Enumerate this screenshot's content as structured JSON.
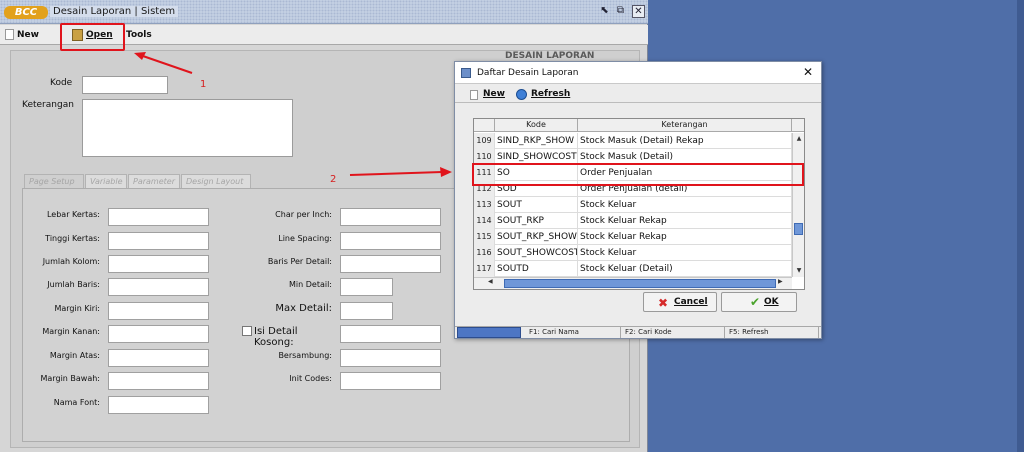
{
  "main_window": {
    "logo": "BCC",
    "title": "Desain Laporan | Sistem",
    "controls": {
      "minmax": "⬉",
      "restore": "⧉",
      "close": "✕"
    },
    "toolbar": {
      "new_label": "New",
      "open_label": "Open",
      "tools_label": "Tools"
    },
    "header": "DESAIN LAPORAN",
    "kode_label": "Kode",
    "keterangan_label": "Keterangan",
    "tabs": [
      "Page Setup",
      "Variable",
      "Parameter",
      "Design Layout"
    ],
    "left_fields": [
      "Lebar Kertas:",
      "Tinggi Kertas:",
      "Jumlah Kolom:",
      "Jumlah Baris:",
      "Margin Kiri:",
      "Margin Kanan:",
      "Margin Atas:",
      "Margin Bawah:",
      "Nama Font:"
    ],
    "right_fields": [
      "Char per Inch:",
      "Line Spacing:",
      "Baris Per Detail:",
      "Min Detail:",
      "Max Detail:",
      "Isi Detail Kosong:",
      "Bersambung:",
      "Init Codes:"
    ]
  },
  "annotations": {
    "step1": "1",
    "step2": "2"
  },
  "dialog": {
    "title": "Daftar Desain Laporan",
    "close": "✕",
    "toolbar": {
      "new_label": "New",
      "refresh_label": "Refresh"
    },
    "columns": [
      "Kode",
      "Keterangan"
    ],
    "rows": [
      {
        "num": "109",
        "kode": "SIND_RKP_SHOW",
        "ket": "Stock Masuk (Detail) Rekap"
      },
      {
        "num": "110",
        "kode": "SIND_SHOWCOST",
        "ket": "Stock Masuk (Detail)"
      },
      {
        "num": "111",
        "kode": "SO",
        "ket": "Order Penjualan"
      },
      {
        "num": "112",
        "kode": "SOD",
        "ket": "Order Penjualan (detail)"
      },
      {
        "num": "113",
        "kode": "SOUT",
        "ket": "Stock Keluar"
      },
      {
        "num": "114",
        "kode": "SOUT_RKP",
        "ket": "Stock Keluar Rekap"
      },
      {
        "num": "115",
        "kode": "SOUT_RKP_SHOW",
        "ket": "Stock Keluar Rekap"
      },
      {
        "num": "116",
        "kode": "SOUT_SHOWCOST",
        "ket": "Stock Keluar"
      },
      {
        "num": "117",
        "kode": "SOUTD",
        "ket": "Stock Keluar (Detail)"
      }
    ],
    "buttons": {
      "cancel_label": "Cancel",
      "ok_label": "OK"
    },
    "status": {
      "f1": "F1: Cari Nama",
      "f2": "F2: Cari Kode",
      "f5": "F5: Refresh"
    }
  }
}
